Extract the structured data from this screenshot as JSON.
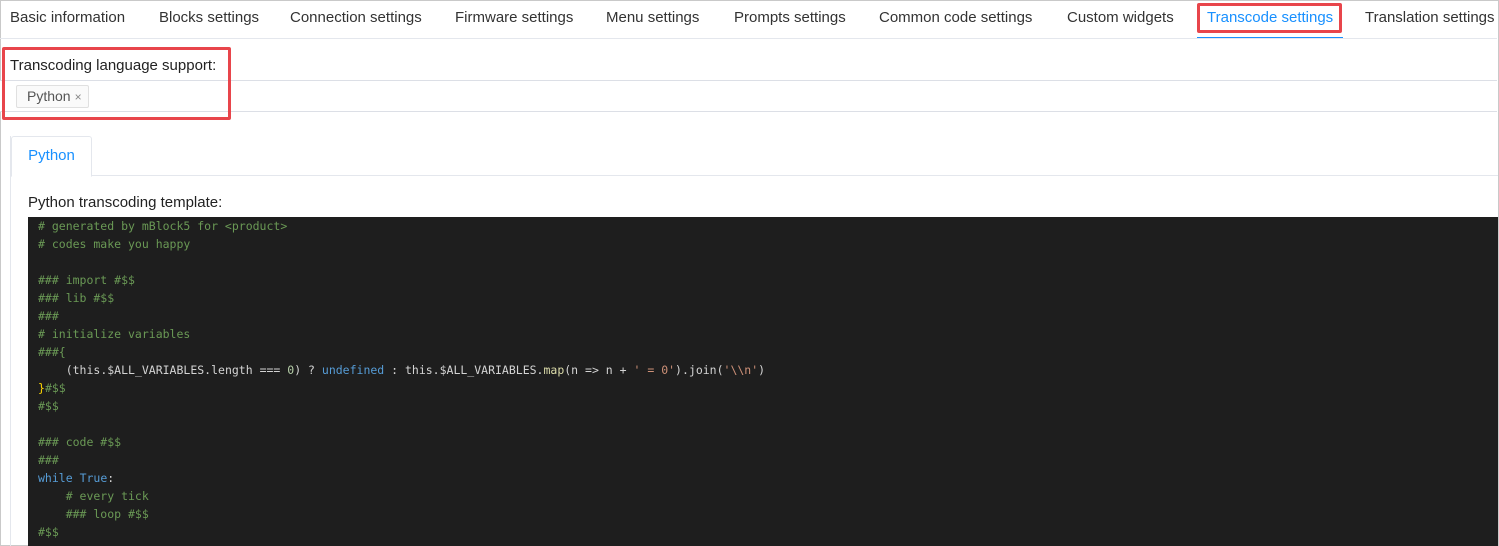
{
  "tabs": [
    {
      "label": "Basic information",
      "active": false
    },
    {
      "label": "Blocks settings",
      "active": false
    },
    {
      "label": "Connection settings",
      "active": false
    },
    {
      "label": "Firmware settings",
      "active": false
    },
    {
      "label": "Menu settings",
      "active": false
    },
    {
      "label": "Prompts settings",
      "active": false
    },
    {
      "label": "Common code settings",
      "active": false
    },
    {
      "label": "Custom widgets",
      "active": false
    },
    {
      "label": "Transcode settings",
      "active": true
    },
    {
      "label": "Translation settings",
      "active": false
    }
  ],
  "language_support": {
    "label": "Transcoding language support:",
    "selected": [
      "Python"
    ],
    "remove_glyph": "×"
  },
  "inner_tabs": [
    {
      "label": "Python",
      "active": true
    }
  ],
  "template": {
    "label": "Python transcoding template:",
    "code": [
      "# generated by mBlock5 for <product>",
      "# codes make you happy",
      "",
      "### import #$$",
      "### lib #$$",
      "###",
      "# initialize variables",
      "###{",
      "    (this.$ALL_VARIABLES.length === 0) ? undefined : this.$ALL_VARIABLES.map(n => n + ' = 0').join('\\\\n')",
      "}#$$",
      "#$$",
      "",
      "### code #$$",
      "###",
      "while True:",
      "    # every tick",
      "    ### loop #$$",
      "#$$"
    ]
  },
  "colors": {
    "accent": "#1890ff",
    "highlight_box": "#e8454b",
    "editor_bg": "#1e1e1e"
  }
}
